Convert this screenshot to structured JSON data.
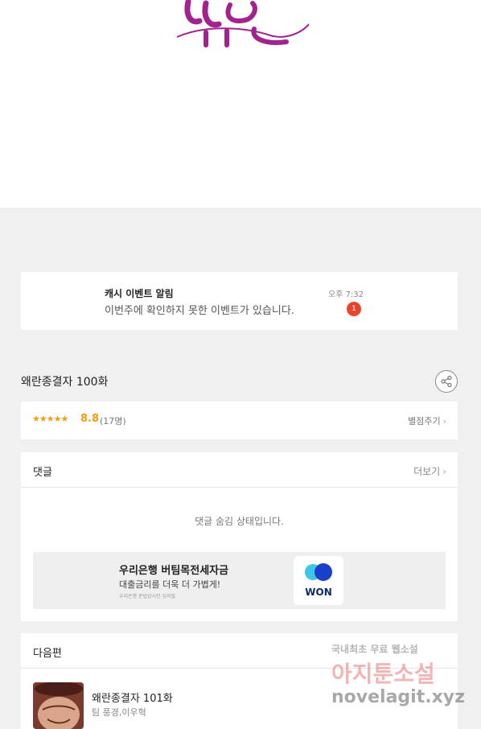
{
  "notification": {
    "title": "캐시 이벤트 알림",
    "message": "이번주에 확인하지 못한 이벤트가 있습니다.",
    "time": "오후 7:32",
    "badge_count": "1"
  },
  "episode": {
    "title": "왜란종결자 100화",
    "stars": "★★★★★",
    "score": "8.8",
    "votes": "(17명)",
    "rate_label": "별점주기"
  },
  "comments": {
    "title": "댓글",
    "more_label": "더보기",
    "hidden_message": "댓글 숨김 상태입니다."
  },
  "ad": {
    "title": "우리은행 버팀목전세자금",
    "subtitle": "대출금리를 더욱 더 가볍게!",
    "fine_print": "우리은행 준법감시인 심의필",
    "logo_text": "WON"
  },
  "next_episode": {
    "section_title": "다음편",
    "title": "왜란종결자 101화",
    "author": "팀 풍경,이우혁"
  },
  "watermark": {
    "line1": "국내최초 무료 웹소설",
    "line2": "아지툰소설",
    "line3": "novelagit.xyz"
  },
  "colors": {
    "accent": "#f39c12",
    "badge": "#e8452c",
    "won_blue": "#1a3fc8",
    "won_cyan": "#3ec6e8",
    "logo_purple": "#a3238e"
  }
}
